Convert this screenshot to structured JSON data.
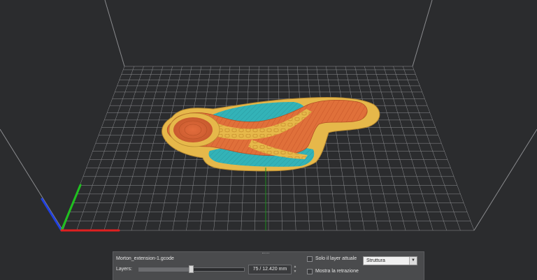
{
  "viewer": {
    "filename": "Morton_extension-1.gcode",
    "layers_label": "Layers:",
    "layer_value": "75 / 12.420 mm",
    "slider_fraction": 0.49,
    "checkbox_current_layer": {
      "label": "Solo il layer attuale",
      "checked": false
    },
    "checkbox_retraction": {
      "label": "Mostra la retrazione",
      "checked": false
    },
    "view_mode": {
      "selected": "Struttura"
    }
  },
  "colors": {
    "background": "#2b2c2e",
    "grid": "#9a9b9e",
    "perimeter": "#e6b84a",
    "infill": "#e0703a",
    "support": "#33b3b8",
    "axis_x": "#e02020",
    "axis_y": "#20c020",
    "axis_z": "#2040e0"
  },
  "icons": {
    "spin_up": "chevron-up-icon",
    "spin_down": "chevron-down-icon",
    "dropdown": "chevron-down-icon"
  }
}
